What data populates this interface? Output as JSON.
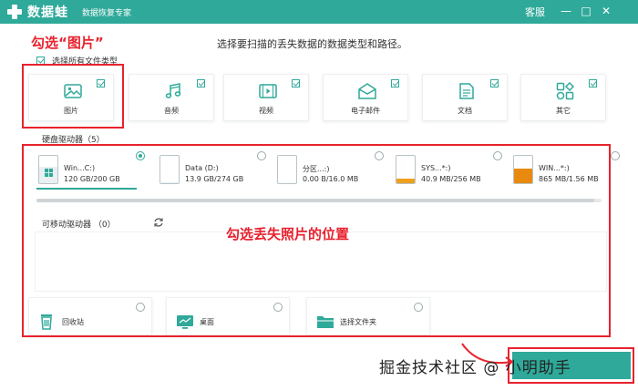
{
  "app": {
    "title": "数据蛙",
    "subtitle": "数据恢复专家",
    "service": "客服",
    "min_glyph": "—",
    "restore_glyph": "□",
    "close_glyph": "✕"
  },
  "instruction": "选择要扫描的丢失数据的数据类型和路径。",
  "select_all_label": "选择所有文件类型",
  "types": [
    {
      "label": "图片",
      "icon": "image-icon",
      "checked": true
    },
    {
      "label": "音频",
      "icon": "music-icon",
      "checked": true
    },
    {
      "label": "视频",
      "icon": "video-icon",
      "checked": true
    },
    {
      "label": "电子邮件",
      "icon": "email-icon",
      "checked": true
    },
    {
      "label": "文档",
      "icon": "document-icon",
      "checked": true
    },
    {
      "label": "其它",
      "icon": "other-icon",
      "checked": true
    }
  ],
  "hard_drives": {
    "label": "硬盘驱动器（5）",
    "items": [
      {
        "name": "Win...C:)",
        "size": "120 GB/200 GB",
        "selected": true,
        "usage": 0.6,
        "fill_color": "#e8f0f2",
        "icon": "windows-drive-icon"
      },
      {
        "name": "Data (D:)",
        "size": "13.9 GB/274 GB",
        "selected": false,
        "usage": 0.05,
        "fill_color": "#e8f0f2",
        "icon": "drive-icon"
      },
      {
        "name": "分区...:)",
        "size": "0.00  B/16.0 MB",
        "selected": false,
        "usage": 0.0,
        "fill_color": "#e8f0f2",
        "icon": "drive-icon"
      },
      {
        "name": "SYS...*:)",
        "size": "40.9 MB/256 MB",
        "selected": false,
        "usage": 0.16,
        "fill_color": "#f0a020",
        "icon": "drive-icon"
      },
      {
        "name": "WIN...*:)",
        "size": "865 MB/1.56 MB",
        "selected": false,
        "usage": 0.55,
        "fill_color": "#e88a10",
        "icon": "drive-icon"
      }
    ]
  },
  "removable": {
    "label": "可移动驱动器 （0）"
  },
  "locations": [
    {
      "label": "回收站",
      "icon": "recycle-bin-icon"
    },
    {
      "label": "桌面",
      "icon": "desktop-icon"
    },
    {
      "label": "选择文件夹",
      "icon": "folder-icon"
    }
  ],
  "annotations": {
    "select_picture": "勾选“图片”",
    "select_location": "勾选丢失照片的位置"
  },
  "watermark": "掘金技术社区 @ 小明助手",
  "colors": {
    "brand": "#2fa99a",
    "annotation": "#e8222e"
  }
}
